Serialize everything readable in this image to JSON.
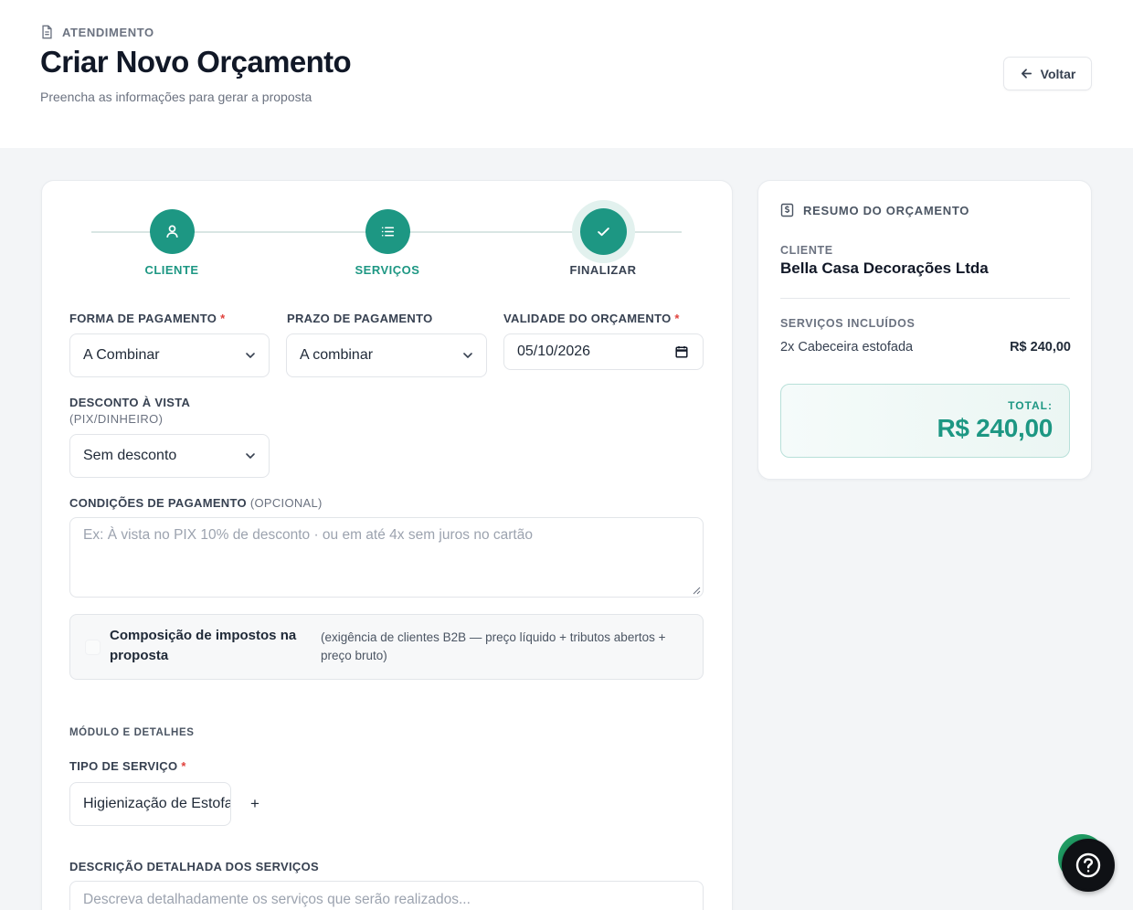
{
  "header": {
    "breadcrumb": "ATENDIMENTO",
    "title": "Criar Novo Orçamento",
    "subtitle": "Preencha as informações para gerar a proposta",
    "back_label": "Voltar"
  },
  "steps": [
    {
      "label": "CLIENTE",
      "icon": "user-icon",
      "state": "done"
    },
    {
      "label": "SERVIÇOS",
      "icon": "list-icon",
      "state": "done"
    },
    {
      "label": "FINALIZAR",
      "icon": "check-icon",
      "state": "active"
    }
  ],
  "form": {
    "payment_method": {
      "label": "FORMA DE PAGAMENTO",
      "required_mark": "*",
      "value": "A Combinar"
    },
    "payment_term": {
      "label": "PRAZO DE PAGAMENTO",
      "value": "A combinar"
    },
    "validity": {
      "label": "VALIDADE DO ORÇAMENTO",
      "required_mark": "*",
      "value": "05/10/2026"
    },
    "cash_discount": {
      "label": "DESCONTO À VISTA",
      "sublabel": "(PIX/DINHEIRO)",
      "value": "Sem desconto"
    },
    "conditions": {
      "label": "CONDIÇÕES DE PAGAMENTO",
      "optional": "(OPCIONAL)",
      "placeholder": "Ex: À vista no PIX 10% de desconto · ou em até 4x sem juros no cartão"
    },
    "tax": {
      "title": "Composição de impostos na proposta",
      "note": "(exigência de clientes B2B — preço líquido + tributos abertos + preço bruto)",
      "checked": false
    },
    "module_section": "MÓDULO E DETALHES",
    "service_type": {
      "label": "TIPO DE SERVIÇO",
      "required_mark": "*",
      "value": "Higienização de Estofados",
      "add_label": "+"
    },
    "description": {
      "label": "DESCRIÇÃO DETALHADA DOS SERVIÇOS",
      "placeholder": "Descreva detalhadamente os serviços que serão realizados..."
    }
  },
  "summary": {
    "title": "RESUMO DO ORÇAMENTO",
    "client_label": "CLIENTE",
    "client_name": "Bella Casa Decorações Ltda",
    "services_label": "SERVIÇOS INCLUÍDOS",
    "services": [
      {
        "name": "2x Cabeceira estofada",
        "price": "R$ 240,00"
      }
    ],
    "total_label": "TOTAL:",
    "total_value": "R$ 240,00"
  },
  "colors": {
    "accent": "#1d9783",
    "danger": "#e0413c"
  }
}
